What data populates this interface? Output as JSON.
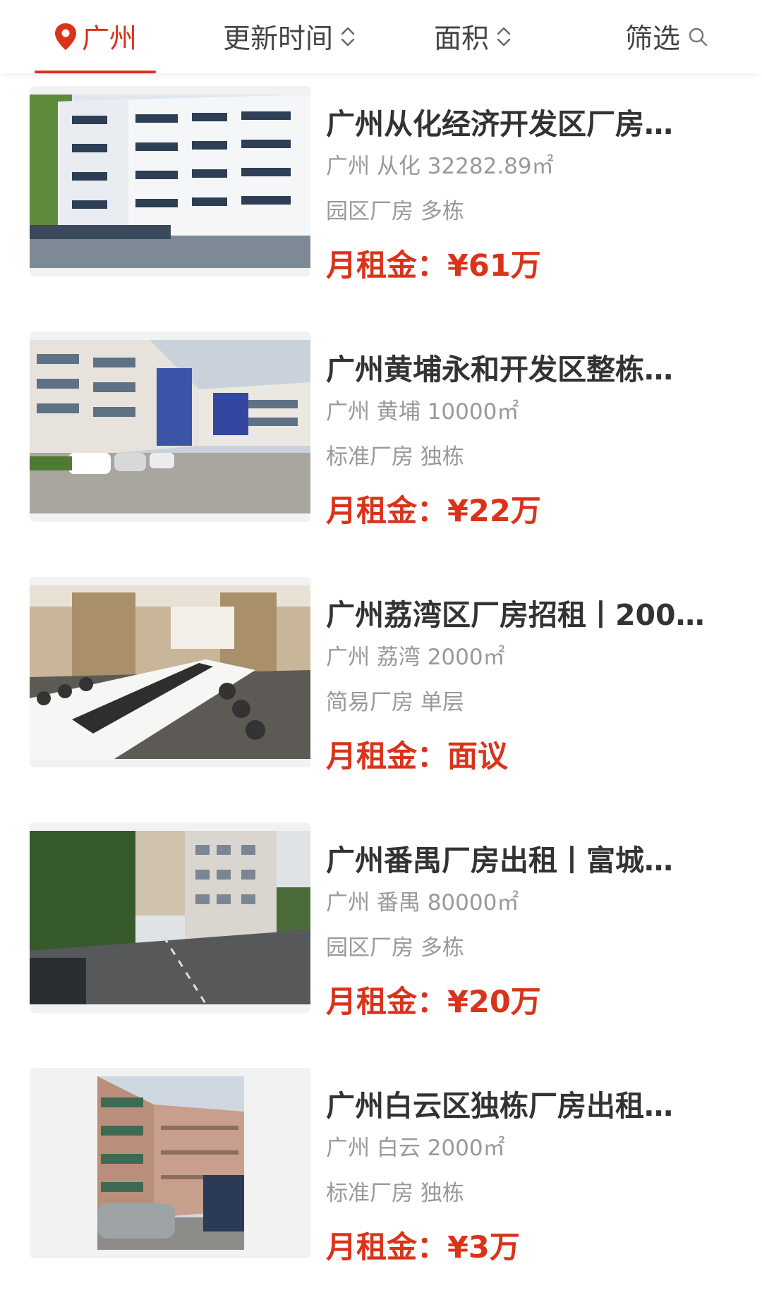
{
  "filter_bar": {
    "city_label": "广州",
    "sort_time_label": "更新时间",
    "sort_area_label": "面积",
    "filter_label": "筛选",
    "accent_color": "#d9331a"
  },
  "listings": [
    {
      "title": "广州从化经济开发区厂房…",
      "meta1": "广州 从化 32282.89㎡",
      "meta2": "园区厂房 多栋",
      "price_label": "月租金：",
      "price_value": "¥61万"
    },
    {
      "title": "广州黄埔永和开发区整栋…",
      "meta1": "广州 黄埔 10000㎡",
      "meta2": "标准厂房 独栋",
      "price_label": "月租金：",
      "price_value": "¥22万"
    },
    {
      "title": "广州荔湾区厂房招租丨200…",
      "meta1": "广州 荔湾 2000㎡",
      "meta2": "简易厂房 单层",
      "price_label": "月租金：",
      "price_value": "面议"
    },
    {
      "title": "广州番禺厂房出租丨富城…",
      "meta1": "广州 番禺 80000㎡",
      "meta2": "园区厂房 多栋",
      "price_label": "月租金：",
      "price_value": "¥20万"
    },
    {
      "title": "广州白云区独栋厂房出租…",
      "meta1": "广州 白云 2000㎡",
      "meta2": "标准厂房 独栋",
      "price_label": "月租金：",
      "price_value": "¥3万"
    }
  ]
}
